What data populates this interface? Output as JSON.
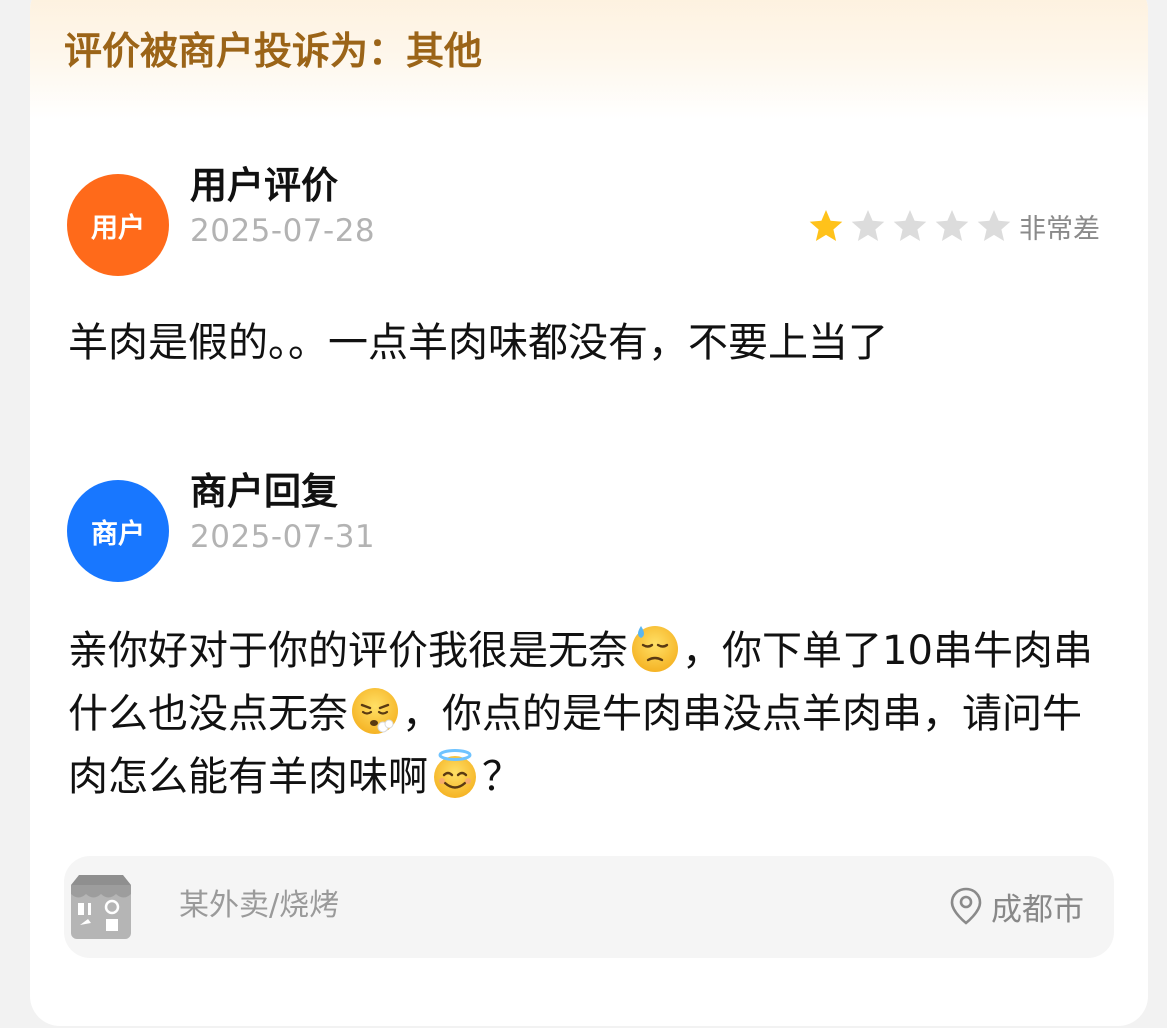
{
  "banner": {
    "title": "评价被商户投诉为：其他"
  },
  "review": {
    "avatar_label": "用户",
    "name": "用户评价",
    "date": "2025-07-28",
    "rating_value": 1,
    "rating_max": 5,
    "rating_label": "非常差",
    "text": "羊肉是假的。。一点羊肉味都没有，不要上当了",
    "colors": {
      "avatar": "#ff6a1a",
      "star_filled": "#ffc21a",
      "star_empty": "#dcdcdc"
    }
  },
  "reply": {
    "avatar_label": "商户",
    "name": "商户回复",
    "date": "2025-07-31",
    "text_parts": {
      "p1": "亲你好对于你的评价我很是无奈",
      "p2": "，你下单了10串牛肉串什么也没点无奈",
      "p3": "，你点的是牛肉串没点羊肉串，请问牛肉怎么能有羊肉味啊",
      "p4": "？"
    },
    "emoji_icons": [
      "downcast-sweat-emoji-icon",
      "exhaling-emoji-icon",
      "halo-smile-emoji-icon"
    ],
    "colors": {
      "avatar": "#1877ff"
    }
  },
  "store": {
    "icon": "store-front-icon",
    "name": "某外卖/烧烤",
    "location_icon": "location-pin-icon",
    "city": "成都市"
  },
  "colors": {
    "banner_text": "#9b6418",
    "banner_bg": "#fdf0dc"
  }
}
